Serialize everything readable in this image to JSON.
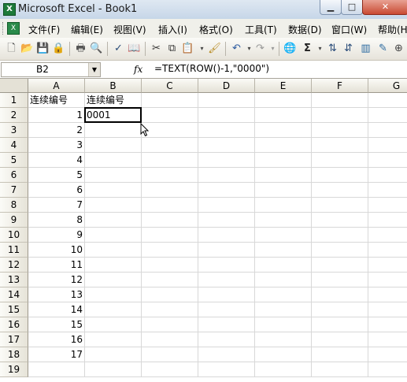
{
  "window": {
    "title": "Microsoft Excel - Book1"
  },
  "menus": [
    "文件(F)",
    "编辑(E)",
    "视图(V)",
    "插入(I)",
    "格式(O)",
    "工具(T)",
    "数据(D)",
    "窗口(W)",
    "帮助(H"
  ],
  "formula_bar": {
    "name_box": "B2",
    "fx": "fx",
    "formula": "=TEXT(ROW()-1,\"0000\")"
  },
  "columns": [
    "A",
    "B",
    "C",
    "D",
    "E",
    "F",
    "G"
  ],
  "rows": [
    "1",
    "2",
    "3",
    "4",
    "5",
    "6",
    "7",
    "8",
    "9",
    "10",
    "11",
    "12",
    "13",
    "14",
    "15",
    "16",
    "17",
    "18",
    "19"
  ],
  "cells": {
    "A": [
      "连续编号",
      "1",
      "2",
      "3",
      "4",
      "5",
      "6",
      "7",
      "8",
      "9",
      "10",
      "11",
      "12",
      "13",
      "14",
      "15",
      "16",
      "17",
      ""
    ],
    "B": [
      "连续编号",
      "0001",
      "",
      "",
      "",
      "",
      "",
      "",
      "",
      "",
      "",
      "",
      "",
      "",
      "",
      "",
      "",
      "",
      ""
    ]
  },
  "selected_cell": "B2"
}
